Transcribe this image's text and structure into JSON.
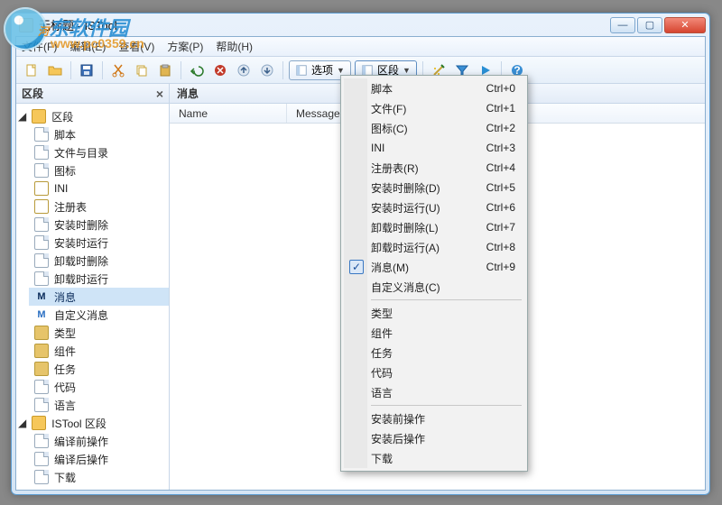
{
  "window": {
    "title": "无标题 - ISTool"
  },
  "watermark": {
    "name": "河东软件园",
    "url": "www.pc0359.cn"
  },
  "menu": {
    "items": [
      "文件(F)",
      "编辑(E)",
      "查看(V)",
      "方案(P)",
      "帮助(H)"
    ]
  },
  "toolbar": {
    "options_label": "选项",
    "sections_label": "区段"
  },
  "sidebar": {
    "title": "区段",
    "groups": [
      {
        "label": "区段",
        "items": [
          {
            "label": "脚本",
            "icon": "doc"
          },
          {
            "label": "文件与目录",
            "icon": "doc"
          },
          {
            "label": "图标",
            "icon": "doc"
          },
          {
            "label": "INI",
            "icon": "ini"
          },
          {
            "label": "注册表",
            "icon": "reg"
          },
          {
            "label": "安装时删除",
            "icon": "doc"
          },
          {
            "label": "安装时运行",
            "icon": "doc"
          },
          {
            "label": "卸载时删除",
            "icon": "doc"
          },
          {
            "label": "卸载时运行",
            "icon": "doc"
          },
          {
            "label": "消息",
            "icon": "mm",
            "selected": true
          },
          {
            "label": "自定义消息",
            "icon": "mm"
          },
          {
            "label": "类型",
            "icon": "comp"
          },
          {
            "label": "组件",
            "icon": "comp"
          },
          {
            "label": "任务",
            "icon": "comp"
          },
          {
            "label": "代码",
            "icon": "doc"
          },
          {
            "label": "语言",
            "icon": "doc"
          }
        ]
      },
      {
        "label": "ISTool 区段",
        "items": [
          {
            "label": "编译前操作",
            "icon": "doc"
          },
          {
            "label": "编译后操作",
            "icon": "doc"
          },
          {
            "label": "下载",
            "icon": "doc"
          }
        ]
      }
    ]
  },
  "content": {
    "title": "消息",
    "columns": [
      "Name",
      "Message"
    ]
  },
  "popup": {
    "items": [
      {
        "label": "脚本",
        "shortcut": "Ctrl+0"
      },
      {
        "label": "文件(F)",
        "shortcut": "Ctrl+1"
      },
      {
        "label": "图标(C)",
        "shortcut": "Ctrl+2"
      },
      {
        "label": "INI",
        "shortcut": "Ctrl+3"
      },
      {
        "label": "注册表(R)",
        "shortcut": "Ctrl+4"
      },
      {
        "label": "安装时删除(D)",
        "shortcut": "Ctrl+5"
      },
      {
        "label": "安装时运行(U)",
        "shortcut": "Ctrl+6"
      },
      {
        "label": "卸载时删除(L)",
        "shortcut": "Ctrl+7"
      },
      {
        "label": "卸载时运行(A)",
        "shortcut": "Ctrl+8"
      },
      {
        "label": "消息(M)",
        "shortcut": "Ctrl+9",
        "checked": true
      },
      {
        "label": "自定义消息(C)",
        "shortcut": ""
      },
      {
        "divider": true
      },
      {
        "label": "类型"
      },
      {
        "label": "组件"
      },
      {
        "label": "任务"
      },
      {
        "label": "代码"
      },
      {
        "label": "语言"
      },
      {
        "divider": true
      },
      {
        "label": "安装前操作"
      },
      {
        "label": "安装后操作"
      },
      {
        "label": "下载"
      }
    ]
  }
}
